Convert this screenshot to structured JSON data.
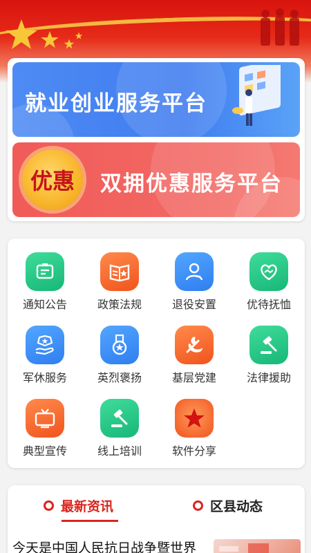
{
  "banners": {
    "employment": {
      "title": "就业创业服务平台"
    },
    "preferential": {
      "badge": "优惠",
      "title": "双拥优惠服务平台"
    }
  },
  "services": [
    {
      "label": "通知公告",
      "icon": "notice-icon",
      "color": "green"
    },
    {
      "label": "政策法规",
      "icon": "policy-book-icon",
      "color": "orange"
    },
    {
      "label": "退役安置",
      "icon": "person-icon",
      "color": "blue"
    },
    {
      "label": "优待抚恤",
      "icon": "heart-hands-icon",
      "color": "green"
    },
    {
      "label": "军休服务",
      "icon": "badge-hand-icon",
      "color": "blue"
    },
    {
      "label": "英烈褒扬",
      "icon": "medal-icon",
      "color": "blue"
    },
    {
      "label": "基层党建",
      "icon": "party-emblem-icon",
      "color": "orange"
    },
    {
      "label": "法律援助",
      "icon": "gavel-icon",
      "color": "green"
    },
    {
      "label": "典型宣传",
      "icon": "tv-icon",
      "color": "orange"
    },
    {
      "label": "线上培训",
      "icon": "gavel-training-icon",
      "color": "green"
    },
    {
      "label": "软件分享",
      "icon": "star-icon",
      "color": "orange"
    }
  ],
  "news": {
    "tabs": [
      {
        "label": "最新资讯",
        "active": true
      },
      {
        "label": "区县动态",
        "active": false
      }
    ],
    "first_title": "今天是中国人民抗日战争暨世界"
  },
  "colors": {
    "accent": "#d9251e",
    "green": "#18b777",
    "orange": "#f0541d",
    "blue": "#2f7ef1"
  }
}
